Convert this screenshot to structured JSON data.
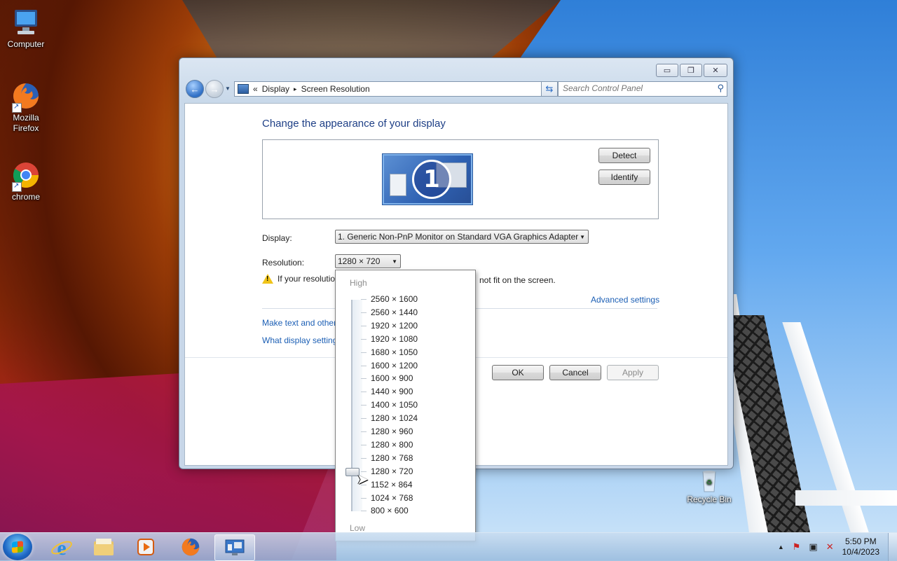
{
  "desktop": {
    "icons": [
      {
        "label": "Computer"
      },
      {
        "label": "Mozilla Firefox"
      },
      {
        "label": "chrome"
      },
      {
        "label": "Recycle Bin"
      }
    ]
  },
  "window": {
    "controls": {
      "minimize": "▭",
      "restore": "❐",
      "close": "✕"
    },
    "nav": {
      "back": "←",
      "forward": "→",
      "dropdown": "▼"
    },
    "address": {
      "prefix": "«",
      "crumbs": [
        "Display",
        "Screen Resolution"
      ],
      "separator": "▸",
      "dropdown": "▼"
    },
    "refresh": "⇆",
    "search": {
      "placeholder": "Search Control Panel",
      "icon": "⚲"
    },
    "heading": "Change the appearance of your display",
    "monitor_number": "1",
    "buttons": {
      "detect": "Detect",
      "identify": "Identify",
      "ok": "OK",
      "cancel": "Cancel",
      "apply": "Apply"
    },
    "display": {
      "label": "Display:",
      "value": "1. Generic Non-PnP Monitor on Standard VGA Graphics Adapter"
    },
    "resolution": {
      "label": "Resolution:",
      "value": "1280 × 720"
    },
    "warning": {
      "before": "If your resolutio",
      "after": "not fit on the screen."
    },
    "links": {
      "advanced": "Advanced settings",
      "make_text": "Make text and other",
      "what_settings": "What display setting"
    }
  },
  "resolution_dropdown": {
    "high_label": "High",
    "low_label": "Low",
    "options": [
      "2560 × 1600",
      "2560 × 1440",
      "1920 × 1200",
      "1920 × 1080",
      "1680 × 1050",
      "1600 × 1200",
      "1600 × 900",
      "1440 × 900",
      "1400 × 1050",
      "1280 × 1024",
      "1280 × 960",
      "1280 × 800",
      "1280 × 768",
      "1280 × 720",
      "1152 × 864",
      "1024 × 768",
      "800 × 600"
    ],
    "selected_index": 13
  },
  "taskbar": {
    "items": [
      "start",
      "internet-explorer",
      "file-explorer",
      "media-player",
      "firefox",
      "control-panel"
    ],
    "tray": {
      "time": "5:50 PM",
      "date": "10/4/2023",
      "show_hidden": "▲"
    }
  },
  "colors": {
    "heading": "#1e3f86",
    "link": "#1c5fb5",
    "accent": "#2f6fc5"
  }
}
